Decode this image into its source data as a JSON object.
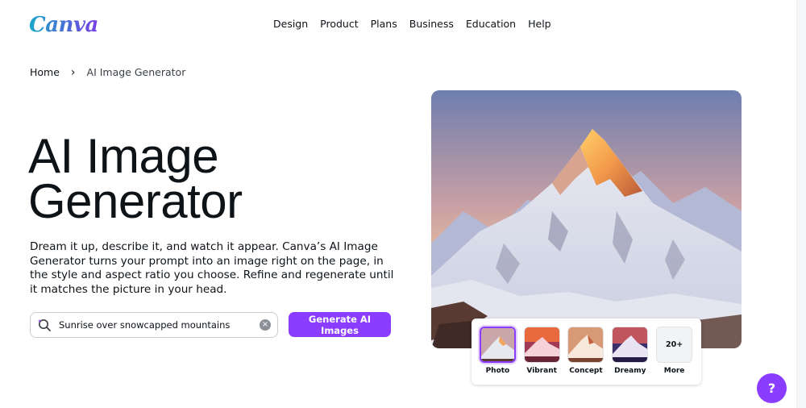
{
  "brand": {
    "logo_text": "Canva",
    "accent": "#8b3dff"
  },
  "nav": {
    "items": [
      "Design",
      "Product",
      "Plans",
      "Business",
      "Education",
      "Help"
    ]
  },
  "breadcrumb": {
    "home": "Home",
    "separator": "›",
    "current": "AI Image Generator"
  },
  "hero": {
    "title_line1": "AI Image",
    "title_line2": "Generator",
    "description": "Dream it up, describe it, and watch it appear. Canva’s AI Image Generator turns your prompt into an image right on the page, in the style and aspect ratio you choose. Refine and regenerate until it matches the picture in your head."
  },
  "search": {
    "value": "Sunrise over snowcapped mountains",
    "placeholder": ""
  },
  "generate_button": {
    "label": "Generate AI Images"
  },
  "styles": {
    "selected": "Photo",
    "options": [
      "Photo",
      "Vibrant",
      "Concept",
      "Dreamy"
    ],
    "more_count": "20+",
    "more_label": "More"
  },
  "help_button": {
    "label": "?"
  }
}
